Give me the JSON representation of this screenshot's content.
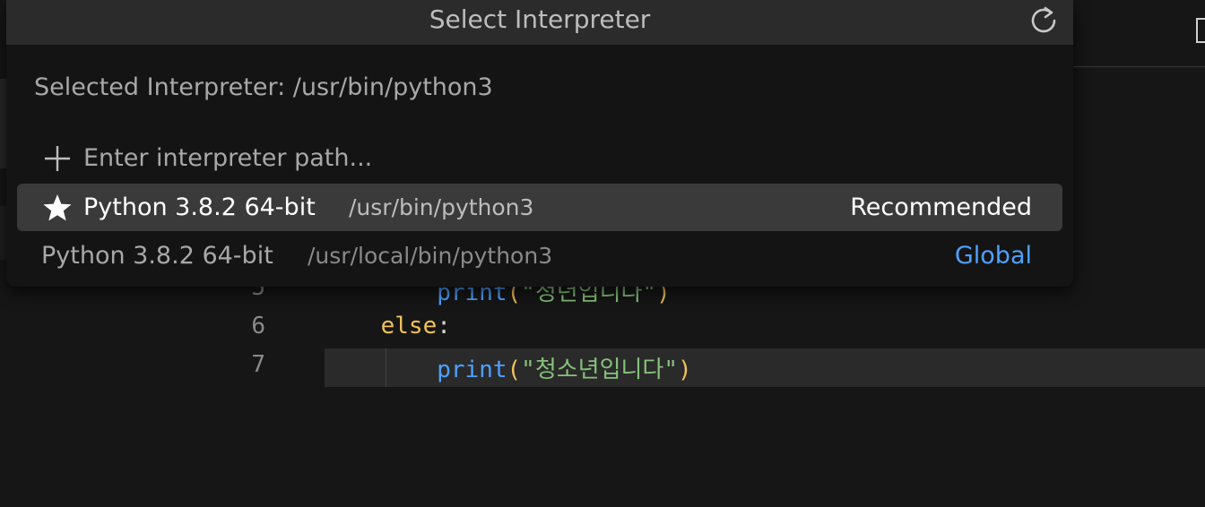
{
  "editor": {
    "lines": [
      {
        "num": "5",
        "indent": "        ",
        "fn": "print",
        "open": "(",
        "str": "\"청년입니다\"",
        "close": ")"
      },
      {
        "num": "6",
        "indent": "    ",
        "kw": "else",
        "colon": ":"
      },
      {
        "num": "7",
        "indent": "        ",
        "fn": "print",
        "open": "(",
        "str": "\"청소년입니다\"",
        "close": ")"
      }
    ]
  },
  "quickpick": {
    "title": "Select Interpreter",
    "refresh_icon": "refresh-icon",
    "selected_label": "Selected Interpreter: /usr/bin/python3",
    "items": [
      {
        "icon": "plus-icon",
        "label": "Enter interpreter path...",
        "desc": "",
        "detail": ""
      },
      {
        "icon": "star-icon",
        "label": "Python 3.8.2 64-bit",
        "desc": "/usr/bin/python3",
        "detail": "Recommended"
      },
      {
        "icon": "",
        "label": "Python 3.8.2 64-bit",
        "desc": "/usr/local/bin/python3",
        "detail": "Global"
      }
    ]
  },
  "colors": {
    "accent_link": "#4ea1ff",
    "active_item_bg": "#3a3a3a",
    "header_bg": "#2b2b2b"
  }
}
